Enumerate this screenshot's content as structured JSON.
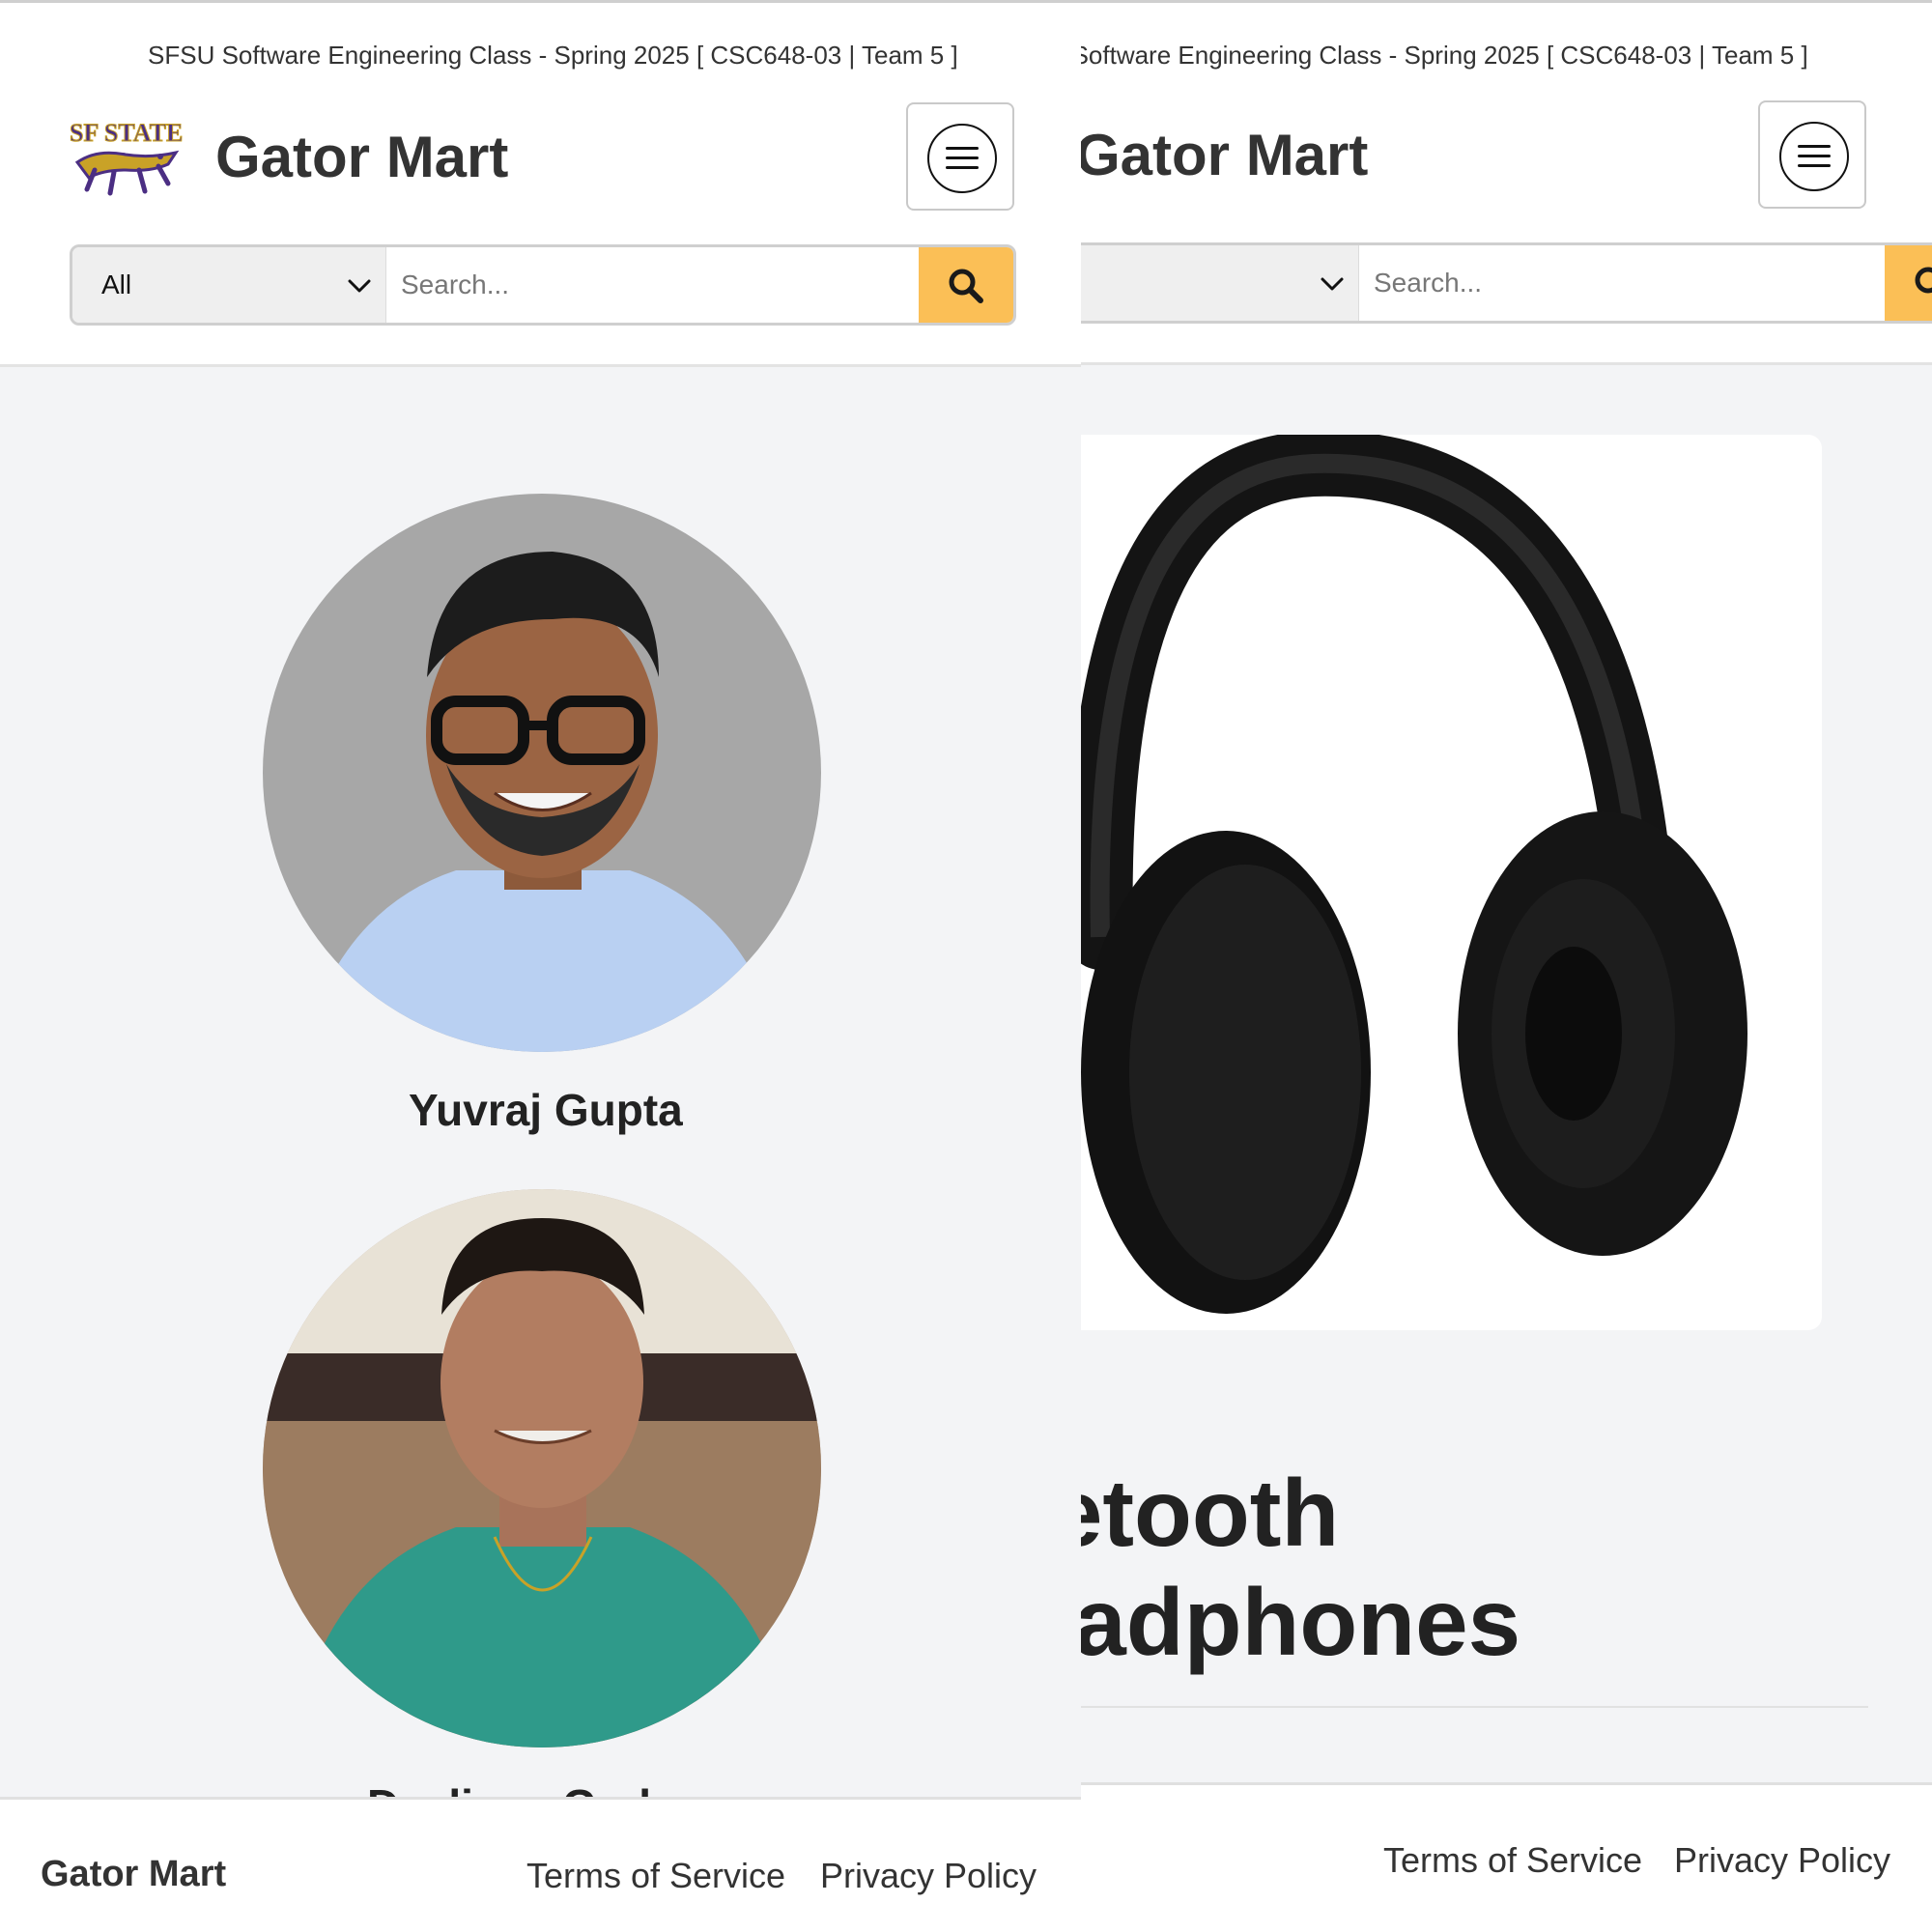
{
  "class_banner": "SFSU Software Engineering Class - Spring 2025 [ CSC648-03 | Team 5 ]",
  "brand": "Gator Mart",
  "logo_text": "SF STATE",
  "search": {
    "category": "All",
    "placeholder": "Search..."
  },
  "team": [
    {
      "name": "Yuvraj Gupta"
    },
    {
      "name": "Deslivan Graham"
    }
  ],
  "product": {
    "title_line1": "Bluetooth",
    "title_line2": "Headphones"
  },
  "footer": {
    "brand": "Gator Mart",
    "terms": "Terms of Service",
    "privacy": "Privacy Policy"
  },
  "colors": {
    "accent": "#fbbf56",
    "content_bg": "#f3f4f6",
    "text": "#222222"
  }
}
